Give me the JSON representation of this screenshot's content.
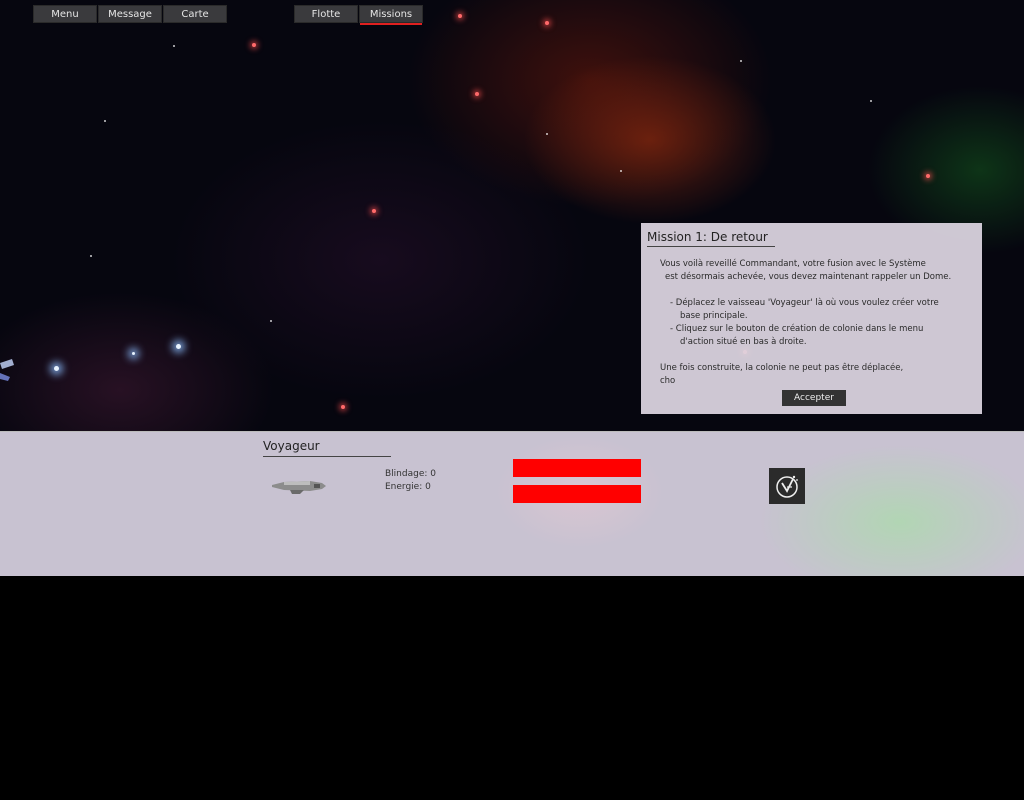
{
  "top_menu": {
    "left": [
      {
        "label": "Menu"
      },
      {
        "label": "Message"
      },
      {
        "label": "Carte"
      }
    ],
    "right": [
      {
        "label": "Flotte"
      },
      {
        "label": "Missions",
        "active": true
      }
    ]
  },
  "mission": {
    "title": "Mission 1: De retour",
    "intro_line1": "Vous voilà reveillé Commandant, votre fusion avec le Système",
    "intro_line2": "est désormais achevée, vous devez maintenant rappeler un Dome.",
    "step1_line1": "- Déplacez le vaisseau 'Voyageur' là où vous voulez créer votre",
    "step1_line2": "base principale.",
    "step2_line1": "- Cliquez sur le bouton de création de colonie dans le menu",
    "step2_line2": "d'action situé en bas à droite.",
    "note_line1": "Une fois construite, la colonie ne peut pas être déplacée,",
    "note_line2": "cho",
    "accept_label": "Accepter"
  },
  "selection": {
    "ship_name": "Voyageur",
    "blindage_label": "Blindage: 0",
    "energie_label": "Energie: 0",
    "armor_fill": 1.0,
    "energy_fill": 1.0,
    "bar_color": "#ff0000"
  },
  "actions": {
    "colony_icon": "colony-clock-icon"
  }
}
